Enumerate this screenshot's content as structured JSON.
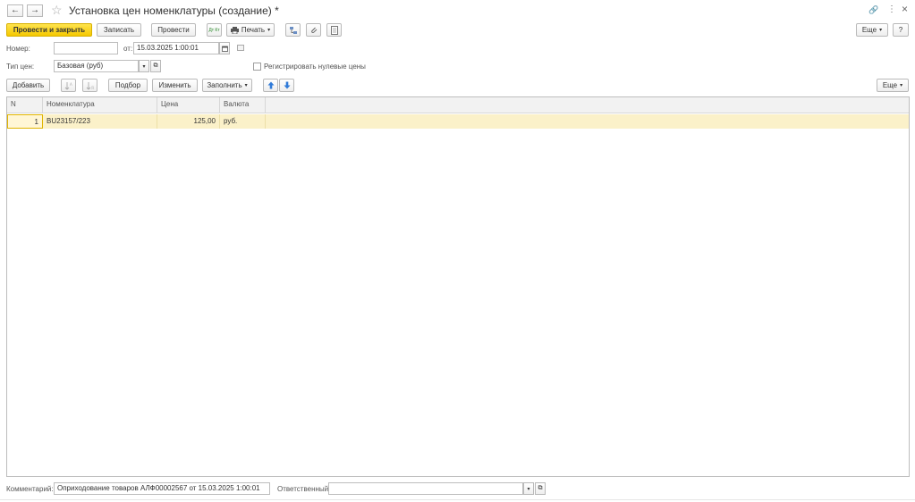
{
  "window": {
    "title": "Установка цен номенклатуры (создание) *",
    "back_glyph": "←",
    "forward_glyph": "→",
    "star_glyph": "☆",
    "link_glyph": "🔗",
    "menu_glyph": "⋮",
    "close_glyph": "×"
  },
  "toolbar": {
    "post_close_label": "Провести и закрыть",
    "save_label": "Записать",
    "post_label": "Провести",
    "dtkt_label": "Дт Кт",
    "print_label": "Печать",
    "more_label": "Еще",
    "help_label": "?"
  },
  "header": {
    "number_label": "Номер:",
    "number_value": "",
    "date_label": "от:",
    "date_value": "15.03.2025  1:00:01",
    "price_type_label": "Тип цен:",
    "price_type_value": "Базовая (руб)",
    "zero_prices_label": "Регистрировать нулевые цены"
  },
  "table_toolbar": {
    "add_label": "Добавить",
    "pick_label": "Подбор",
    "change_label": "Изменить",
    "fill_label": "Заполнить",
    "more_label": "Еще"
  },
  "table": {
    "columns": [
      "N",
      "Номенклатура",
      "Цена",
      "Валюта"
    ],
    "rows": [
      {
        "n": "1",
        "item": "BU23157/223",
        "price": "125,00",
        "currency": "руб."
      }
    ]
  },
  "footer": {
    "comment_label": "Комментарий:",
    "comment_value": "Оприходование товаров АЛФ00002567 от 15.03.2025 1:00:01",
    "responsible_label": "Ответственный:",
    "responsible_value": ""
  },
  "colors": {
    "primary_button": "#f5c800",
    "selected_row": "#fbf1c9",
    "arrow_blue": "#2f7ad8"
  }
}
